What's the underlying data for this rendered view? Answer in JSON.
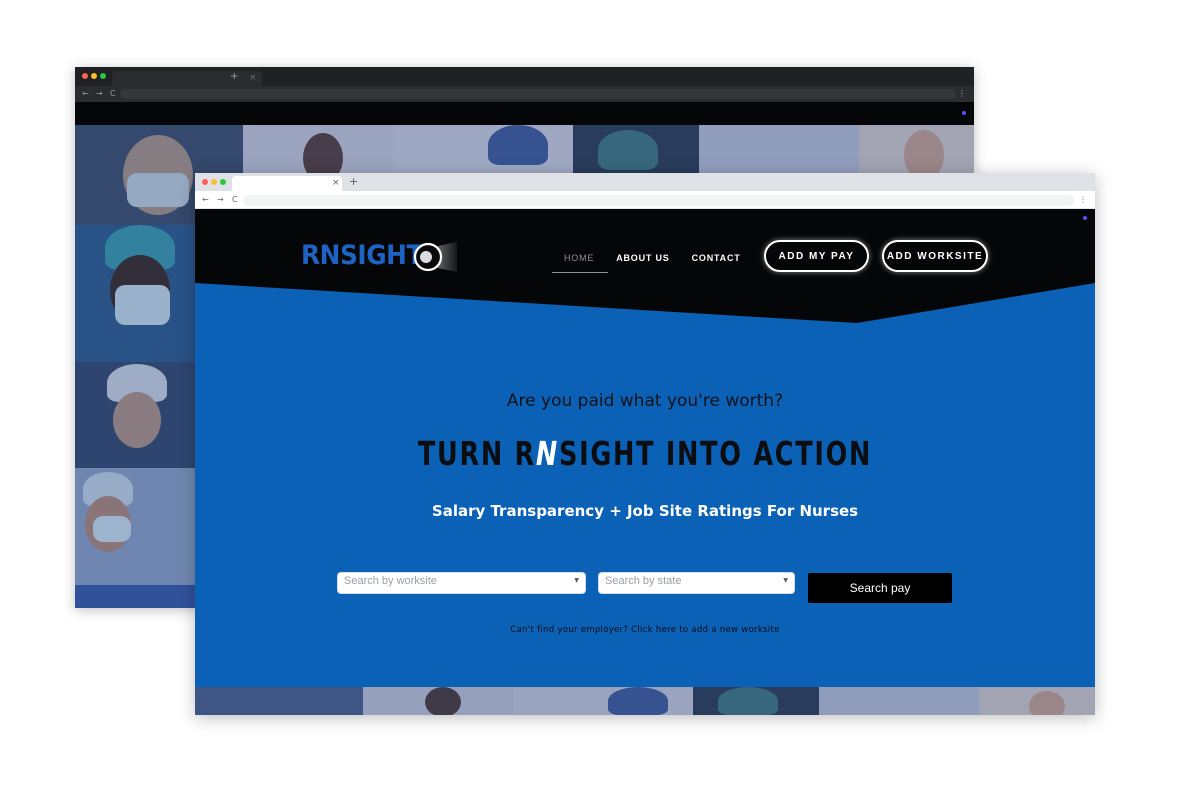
{
  "back_window": {
    "tab_close": "×",
    "new_tab": "+",
    "nav_icons": [
      "←",
      "→",
      "C"
    ],
    "menu": "⋮"
  },
  "front_window": {
    "tab_close": "×",
    "new_tab": "+",
    "nav_icons": [
      "←",
      "→",
      "C"
    ],
    "menu": "⋮"
  },
  "site": {
    "logo_text": "RNSIGHT",
    "nav": [
      {
        "label": "HOME",
        "active": true
      },
      {
        "label": "ABOUT US",
        "active": false
      },
      {
        "label": "CONTACT",
        "active": false
      }
    ],
    "add_pay_label": "ADD MY PAY",
    "add_worksite_label": "ADD WORKSITE",
    "hero_question": "Are you paid what you're worth?",
    "hero_title_before": "TURN R",
    "hero_title_accent": "N",
    "hero_title_after": "SIGHT INTO ACTION",
    "hero_subtitle": "Salary Transparency + Job Site Ratings For Nurses",
    "worksite_placeholder": "Search by worksite",
    "state_placeholder": "Search by state",
    "search_button_label": "Search pay",
    "helper_link": "Can't find your employer? Click here to add a new worksite"
  },
  "colors": {
    "brand_blue": "#0b61b6",
    "logo_blue": "#1e63c4",
    "header_black": "#050607",
    "accent_dot": "#5b4dff"
  }
}
